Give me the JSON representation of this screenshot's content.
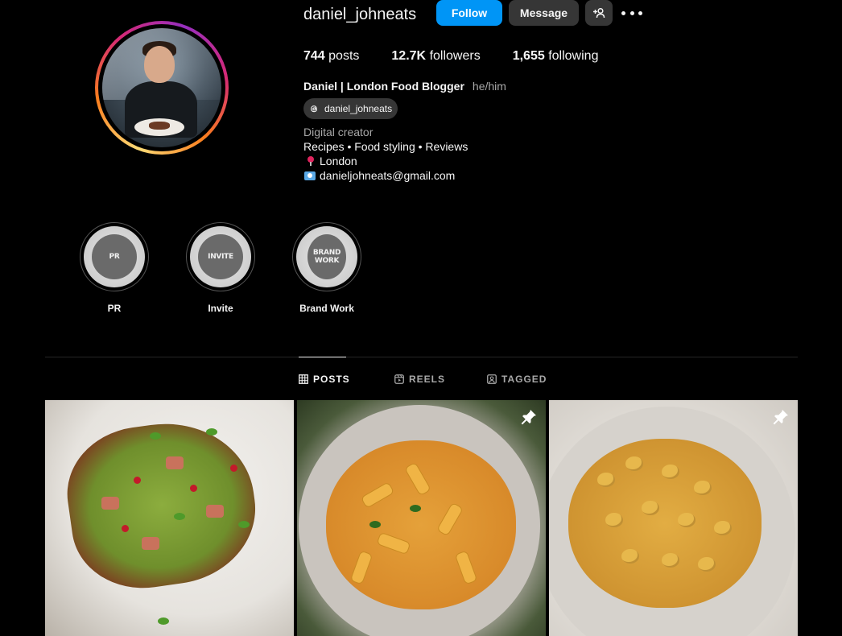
{
  "profile": {
    "username": "daniel_johneats",
    "follow_label": "Follow",
    "message_label": "Message",
    "stats": {
      "posts_count": "744",
      "posts_label": "posts",
      "followers_count": "12.7K",
      "followers_label": "followers",
      "following_count": "1,655",
      "following_label": "following"
    },
    "full_name": "Daniel | London Food Blogger",
    "pronouns": "he/him",
    "threads_handle": "daniel_johneats",
    "category": "Digital creator",
    "bio_lines": [
      "Recipes • Food styling • Reviews",
      "London",
      "danieljohneats@gmail.com"
    ]
  },
  "highlights": [
    {
      "label": "PR",
      "cover_text": "PR"
    },
    {
      "label": "Invite",
      "cover_text": "INVITE"
    },
    {
      "label": "Brand Work",
      "cover_text": "BRAND WORK"
    }
  ],
  "tabs": [
    {
      "label": "POSTS",
      "icon": "grid-icon",
      "active": true
    },
    {
      "label": "REELS",
      "icon": "reels-icon",
      "active": false
    },
    {
      "label": "TAGGED",
      "icon": "tagged-icon",
      "active": false
    }
  ],
  "posts": [
    {
      "subject": "avocado toast with bacon, pomegranate and pea shoots",
      "pinned": false
    },
    {
      "subject": "rigatoni in creamy tomato sauce with parsley",
      "pinned": true
    },
    {
      "subject": "crispy gnocchi with parmesan and black pepper",
      "pinned": true
    }
  ],
  "colors": {
    "background": "#000000",
    "follow_button": "#0095f6",
    "secondary_button": "#363636",
    "muted_text": "#a8a8a8"
  }
}
